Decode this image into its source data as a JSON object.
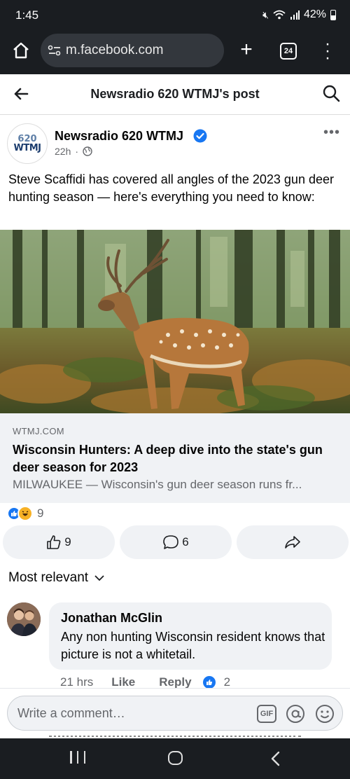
{
  "status_bar": {
    "time": "1:45",
    "battery": "42%"
  },
  "browser": {
    "url": "m.facebook.com",
    "tab_count": "24"
  },
  "header": {
    "title": "Newsradio 620 WTMJ's post"
  },
  "post": {
    "page_name": "Newsradio 620 WTMJ",
    "avatar_top": "620",
    "avatar_bottom": "WTMJ",
    "time": "22h",
    "text": "Steve Scaffidi has covered all angles of the 2023 gun deer hunting season — here's everything you need to know:",
    "link": {
      "domain": "WTMJ.COM",
      "title": "Wisconsin Hunters: A deep dive into the state's gun deer season for 2023",
      "description": "MILWAUKEE — Wisconsin's gun deer season runs fr..."
    },
    "reaction_count": "9",
    "like_count": "9",
    "comment_count": "6"
  },
  "comments": {
    "sort_label": "Most relevant",
    "items": [
      {
        "author": "Jonathan McGlin",
        "text": "Any non hunting Wisconsin resident knows that picture is not a whitetail.",
        "time": "21 hrs",
        "like_label": "Like",
        "reply_label": "Reply",
        "reaction_count": "2"
      }
    ]
  },
  "composer": {
    "placeholder": "Write a comment…",
    "gif_label": "GIF"
  },
  "colors": {
    "facebook_blue": "#1877f2",
    "dark_bar": "#1a1d21",
    "light_gray": "#f0f2f5"
  }
}
